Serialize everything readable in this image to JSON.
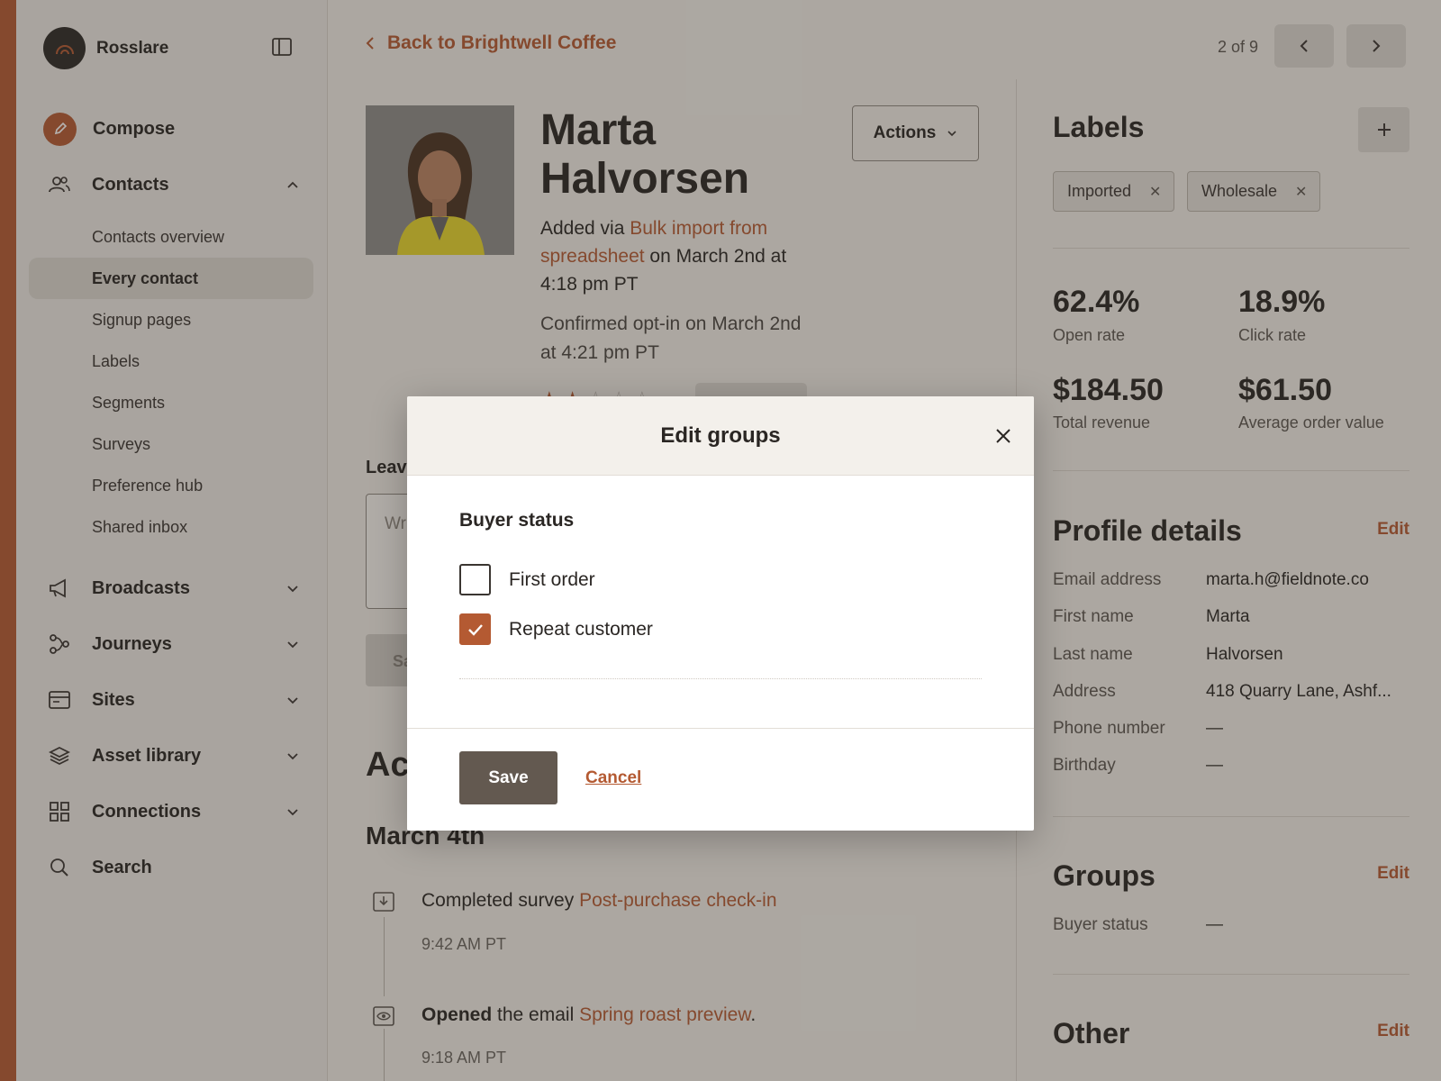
{
  "sidebar": {
    "brand_name": "Rosslare",
    "compose_label": "Compose",
    "contacts_label": "Contacts",
    "contacts_subitems": [
      "Contacts overview",
      "Every contact",
      "Signup pages",
      "Labels",
      "Segments",
      "Surveys",
      "Preference hub",
      "Shared inbox"
    ],
    "active_subitem": "Every contact",
    "broadcasts_label": "Broadcasts",
    "journeys_label": "Journeys",
    "sites_label": "Sites",
    "asset_library_label": "Asset library",
    "connections_label": "Connections",
    "search_label": "Search"
  },
  "header": {
    "back_label": "Back to Brightwell Coffee",
    "pager_text": "2 of 9"
  },
  "contact": {
    "name": "Marta Halvorsen",
    "added_prefix": "Added via ",
    "added_link": "Bulk import from spreadsheet",
    "added_suffix": " on March 2nd at 4:18 pm PT",
    "optin": "Confirmed opt-in on March 2nd at 4:21 pm PT",
    "rating": 2,
    "rating_max": 5,
    "actions_label": "Actions"
  },
  "note": {
    "label": "Leave",
    "placeholder": "Wri",
    "save_label": "Sa"
  },
  "activity": {
    "title": "Ac",
    "date": "March 4th",
    "items": [
      {
        "prefix": "Completed survey ",
        "bold": "",
        "link": "Post-purchase check-in",
        "suffix": "",
        "time": "9:42 AM PT",
        "icon": "download-icon"
      },
      {
        "prefix": "",
        "bold": "Opened",
        "mid": " the email ",
        "link": "Spring roast preview",
        "suffix": ".",
        "time": "9:18 AM PT",
        "icon": "eye-icon"
      }
    ]
  },
  "labels": {
    "title": "Labels",
    "chips": [
      "Imported",
      "Wholesale"
    ]
  },
  "stats": [
    {
      "value": "62.4%",
      "label": "Open rate"
    },
    {
      "value": "18.9%",
      "label": "Click rate"
    },
    {
      "value": "$184.50",
      "label": "Total revenue"
    },
    {
      "value": "$61.50",
      "label": "Average order value"
    }
  ],
  "profile": {
    "title": "Profile details",
    "edit_label": "Edit",
    "fields": [
      {
        "key": "Email address",
        "value": "marta.h@fieldnote.co"
      },
      {
        "key": "First name",
        "value": "Marta"
      },
      {
        "key": "Last name",
        "value": "Halvorsen"
      },
      {
        "key": "Address",
        "value": "418 Quarry Lane, Ashf..."
      },
      {
        "key": "Phone number",
        "value": "—"
      },
      {
        "key": "Birthday",
        "value": "—"
      }
    ]
  },
  "groups": {
    "title": "Groups",
    "edit_label": "Edit",
    "buyer_status_key": "Buyer status",
    "buyer_status_value": "—"
  },
  "other": {
    "title": "Other",
    "edit_label": "Edit"
  },
  "modal": {
    "title": "Edit groups",
    "group_label": "Buyer status",
    "options": [
      {
        "label": "First order",
        "checked": false
      },
      {
        "label": "Repeat customer",
        "checked": true
      }
    ],
    "save_label": "Save",
    "cancel_label": "Cancel"
  },
  "colors": {
    "accent": "#b45a32",
    "save_button": "#635950",
    "sidebar_bg": "#ece8e3",
    "page_bg": "#f1ede7"
  }
}
